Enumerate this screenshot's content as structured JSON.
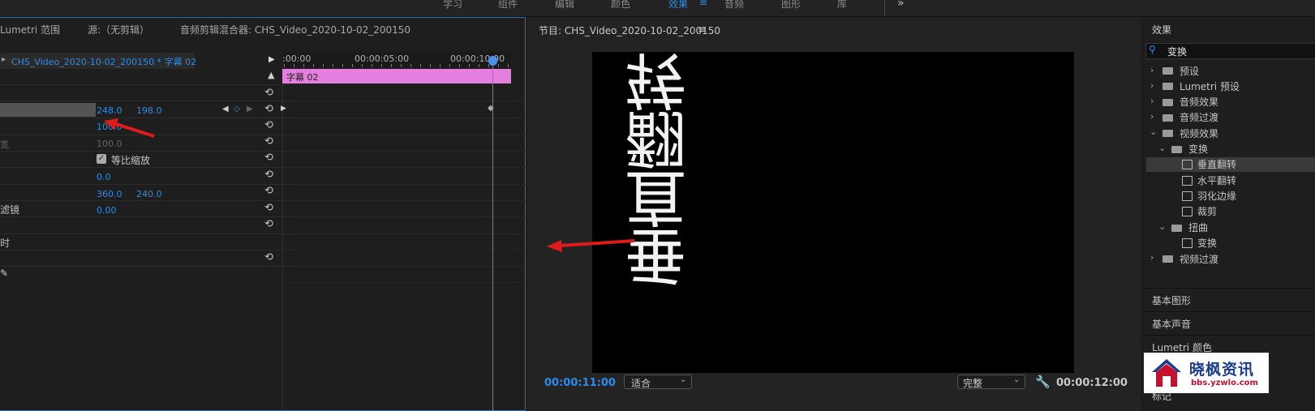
{
  "workspace_tabs": [
    "学习",
    "组件",
    "编辑",
    "颜色",
    "效果",
    "音频",
    "图形",
    "库"
  ],
  "workspace_menu_icon": "≡",
  "overflow_icon": "»",
  "left_tabs": {
    "lumetri": "Lumetri 范围",
    "source": "源:（无剪辑）",
    "mixer": "音频剪辑混合器: CHS_Video_2020-10-02_200150"
  },
  "effect_controls": {
    "clip_title": "CHS_Video_2020-10-02_200150 * 字幕 02",
    "position": {
      "x": "248.0",
      "y": "198.0"
    },
    "scale": "100.0",
    "scale_width": "100.0",
    "scale_width_label": "宽",
    "uniform_scale": "等比缩放",
    "rotation": "0.0",
    "anchor": {
      "x": "360.0",
      "y": "240.0"
    },
    "antiflicker_label": "滤镜",
    "antiflicker": "0.00",
    "time_label": "时"
  },
  "timeline": {
    "ticks": [
      ":00:00",
      "00:00:05:00",
      "00:00:10:00"
    ],
    "clip_label": "字幕 02",
    "clip_color": "#e57fdf"
  },
  "program": {
    "title": "节目: CHS_Video_2020-10-02_200150",
    "menu_icon": "≡",
    "timecode_current": "00:00:11:00",
    "zoom": "适合",
    "quality": "完整",
    "timecode_duration": "00:00:12:00",
    "caption_text": "垂直翻转"
  },
  "effects_panel": {
    "title": "效果",
    "search_value": "变换",
    "tree": [
      {
        "label": "预设",
        "type": "preset",
        "level": 0,
        "expanded": false
      },
      {
        "label": "Lumetri 预设",
        "type": "preset",
        "level": 0,
        "expanded": false
      },
      {
        "label": "音频效果",
        "type": "folder",
        "level": 0,
        "expanded": false
      },
      {
        "label": "音频过渡",
        "type": "folder",
        "level": 0,
        "expanded": false
      },
      {
        "label": "视频效果",
        "type": "folder",
        "level": 0,
        "expanded": true
      },
      {
        "label": "变换",
        "type": "folder",
        "level": 1,
        "expanded": true
      },
      {
        "label": "垂直翻转",
        "type": "effect",
        "level": 2,
        "selected": true
      },
      {
        "label": "水平翻转",
        "type": "effect",
        "level": 2
      },
      {
        "label": "羽化边缘",
        "type": "effect",
        "level": 2
      },
      {
        "label": "裁剪",
        "type": "effect",
        "level": 2
      },
      {
        "label": "扭曲",
        "type": "folder",
        "level": 1,
        "expanded": true
      },
      {
        "label": "变换",
        "type": "effect",
        "level": 2
      },
      {
        "label": "视频过渡",
        "type": "folder",
        "level": 0,
        "expanded": false
      }
    ],
    "sections": [
      "基本图形",
      "基本声音",
      "Lumetri 颜色",
      "标记"
    ]
  },
  "watermark": {
    "name": "晓枫资讯",
    "url": "bbs.yzwlo.com"
  },
  "colors": {
    "accent_blue": "#2d8ceb",
    "annotation_red": "#e01b1b",
    "playhead": "#4a90e2"
  }
}
